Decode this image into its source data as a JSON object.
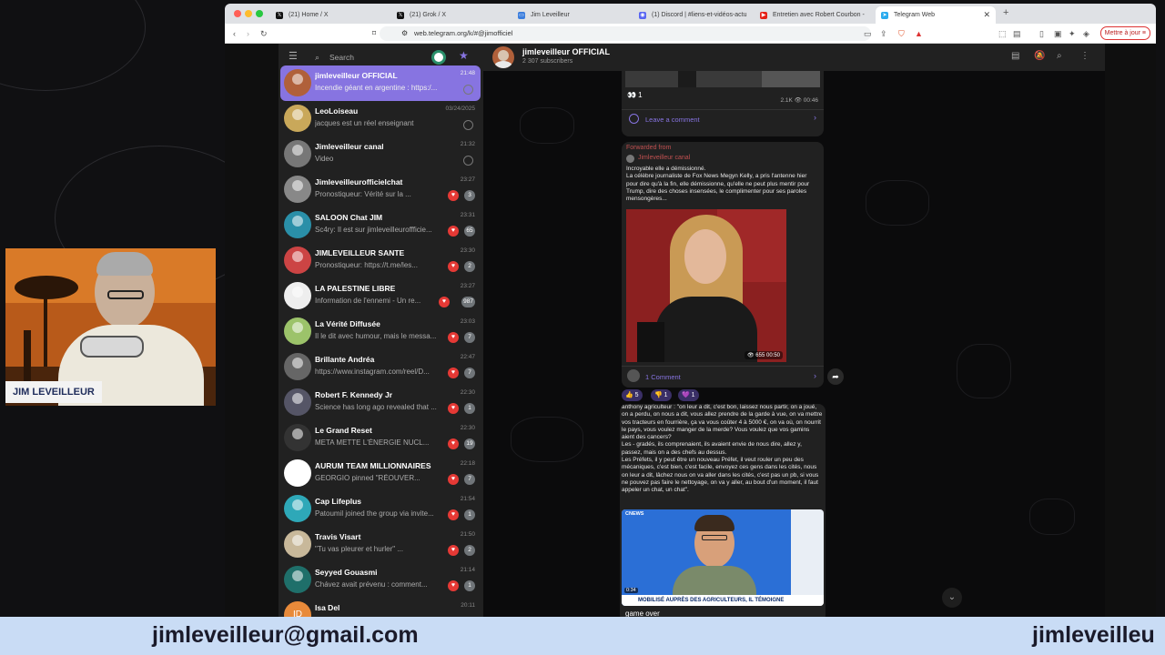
{
  "browser": {
    "tabs": [
      {
        "label": "(21) Home / X",
        "icon": "x-icon"
      },
      {
        "label": "(21) Grok / X",
        "icon": "x-icon"
      },
      {
        "label": "Jim Leveilleur",
        "icon": "window-icon"
      },
      {
        "label": "(1) Discord | #liens-et-vidéos-actu",
        "icon": "discord-icon"
      },
      {
        "label": "Entretien avec Robert Courbon -",
        "icon": "youtube-icon"
      },
      {
        "label": "Telegram Web",
        "icon": "telegram-icon",
        "active": true
      }
    ],
    "url": "web.telegram.org/k/#@jimofficiel",
    "update_button": "Mettre à jour"
  },
  "sidebar": {
    "search_placeholder": "Search",
    "chats": [
      {
        "name": "jimleveilleur OFFICIAL",
        "preview": "Incendie géant en argentine : https:/...",
        "time": "21:48",
        "active": true,
        "color": "#b0603a"
      },
      {
        "name": "LeoLoiseau",
        "preview": "jacques est un réel enseignant",
        "time": "03/24/2025",
        "color": "#c9a85a"
      },
      {
        "name": "Jimleveilleur canal",
        "preview": "Video",
        "time": "21:32",
        "color": "#777777"
      },
      {
        "name": "Jimleveilleurofficielchat",
        "preview": "Pronostiqueur: Vérité sur la ...",
        "time": "23:27",
        "badge": "3",
        "color": "#888888"
      },
      {
        "name": "SALOON Chat JIM",
        "preview": "Sc4ry: Il est sur jimleveilleuroffficie...",
        "time": "23:31",
        "badge": "65",
        "color": "#2a8fa8"
      },
      {
        "name": "JIMLEVEILLEUR SANTE",
        "preview": "Pronostiqueur: https://t.me/les...",
        "time": "23:30",
        "badge": "2",
        "color": "#cc4444"
      },
      {
        "name": "LA PALESTINE LIBRE",
        "preview": "Information de l'ennemi - Un re...",
        "time": "23:27",
        "badge": "987",
        "color": "#eeeeee"
      },
      {
        "name": "La Vérité Diffusée",
        "preview": "Il le dit avec humour, mais le messa...",
        "time": "23:03",
        "badge": "7",
        "color": "#9cc36a"
      },
      {
        "name": "Brillante Andréa",
        "preview": "https://www.instagram.com/reel/D...",
        "time": "22:47",
        "badge": "7",
        "color": "#666666"
      },
      {
        "name": "Robert F. Kennedy Jr",
        "preview": "Science has long ago revealed that ...",
        "time": "22:30",
        "badge": "1",
        "color": "#555566"
      },
      {
        "name": "Le Grand Reset",
        "preview": "META METTE L'ÉNERGIE NUCL...",
        "time": "22:30",
        "badge": "19",
        "color": "#333333"
      },
      {
        "name": "AURUM TEAM MILLIONNAIRES",
        "preview": "GEORGIO pinned \"RÉOUVER...",
        "time": "22:18",
        "badge": "7",
        "color": "#ffffff"
      },
      {
        "name": "Cap Lifeplus",
        "preview": "Patoumil joined the group via invite...",
        "time": "21:54",
        "badge": "1",
        "color": "#2ea8b8"
      },
      {
        "name": "Travis Visart",
        "preview": "\"Tu vas pleurer et hurler\" ...",
        "time": "21:50",
        "badge": "2",
        "color": "#c8b89a"
      },
      {
        "name": "Seyyed Gouasmi",
        "preview": "Chávez avait prévenu : comment...",
        "time": "21:14",
        "badge": "1",
        "color": "#1f6f6a"
      },
      {
        "name": "Isa Del",
        "preview": "",
        "time": "20:11",
        "initials": "ID",
        "color": "#e88a3a"
      }
    ]
  },
  "chat": {
    "title": "jimleveilleur OFFICIAL",
    "subscribers": "2 307 subscribers",
    "msg1": {
      "reaction": "👀 1",
      "views": "2.1K",
      "time": "00:46",
      "comment": "Leave a comment"
    },
    "msg2": {
      "forwarded_label": "Forwarded from",
      "forwarded_from": "Jimleveilleur canal",
      "text": "Incroyable elle a démissionné.\nLa célèbre journaliste de Fox News Megyn Kelly, a pris l'antenne hier pour dire qu'à la fin, elle démissionne, qu'elle ne peut plus mentir pour Trump, dire des choses insensées, le complimenter pour ses paroles mensongères...",
      "views": "655",
      "duration": "00:50",
      "comments": "1 Comment",
      "reactions": [
        "👍 5",
        "👎 1",
        "💜 1"
      ]
    },
    "msg3": {
      "text": "anthony agriculteur : \"on leur a dit, c'est bon, laissez nous partir, on a joué, on a perdu, on nous a dit, vous allez prendre de la garde à vue, on va mettre vos tracteurs en fourrière, ça va vous coûter 4 à 5000 €, on va où, on nourrit le pays, vous voulez manger de la merde? Vous voulez que vos gamins aient des cancers?\nLes - gradés, ils comprenaient, ils avaient envie de nous dire, allez y, passez, mais on a des chefs au dessus.\nLes Préfets, il y peut être un nouveau Préfet, il veut rouler un peu des mécaniques, c'est bien, c'est facile, envoyez ces gens dans les cités, nous on leur a dit, lâchez nous on va aller dans les cités, c'est pas un pb, si vous ne pouvez pas faire le nettoyage, on va y aller, au bout d'un moment, il faut appeler un chat, un chat\".",
      "video_caption": "MOBILISÉ AUPRÈS DES AGRICULTEURS, IL TÉMOIGNE",
      "video_time": "0:34",
      "channel_tag": "CNEWS",
      "footer": "game over"
    }
  },
  "webcam": {
    "label": "JIM LEVEILLEUR"
  },
  "banner": {
    "email": "jimleveilleur@gmail.com",
    "email_partial": "jimleveilleu"
  }
}
